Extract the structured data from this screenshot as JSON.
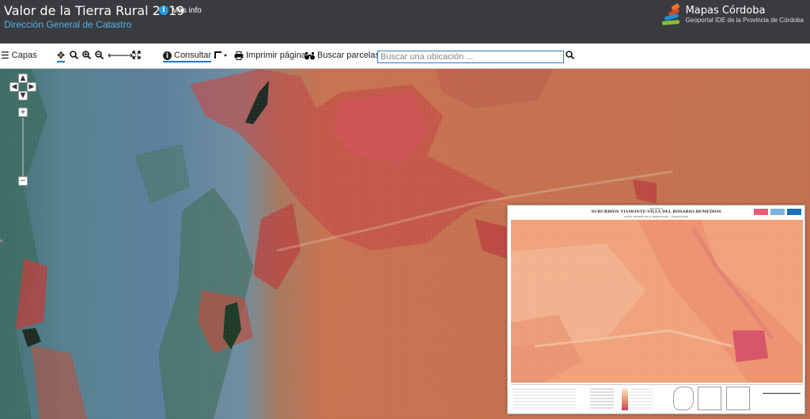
{
  "header": {
    "title": "Valor de la Tierra Rural 2019",
    "subtitle": "Dirección General de Catastro",
    "more_info": "Más info",
    "brand_name": "Mapas Córdoba",
    "brand_tagline": "Geoportal IDE de la Provincia de Córdoba"
  },
  "toolbar": {
    "layers_label": "Capas",
    "consult_label": "Consultar",
    "print_label": "Imprimir página",
    "parcel_label": "Buscar parcelas",
    "search_placeholder": "Buscar una ubicación ..."
  },
  "icons": {
    "menu": "hamburger-icon",
    "pan": "move-arrows-icon",
    "zoom_search": "magnifier-icon",
    "zoom_in": "zoom-in-icon",
    "zoom_out": "zoom-out-icon",
    "back": "arrow-left-icon",
    "forward": "arrow-right-icon",
    "extent": "full-extent-icon",
    "info": "info-icon",
    "measure": "measure-icon",
    "print": "printer-icon",
    "binoculars": "binoculars-icon",
    "search": "search-icon"
  },
  "map": {
    "zoom_in_label": "+",
    "zoom_out_label": "−"
  },
  "inset": {
    "kicker": "PROVINCIA",
    "title": "SUBURBIOS VIAMONTE-VILLA DEL ROSARIO-REMEDIOS",
    "subtitle": "VALOR UNITARIO DE LA TIERRA RURAL - VIGENCIA 2019"
  },
  "colors": {
    "header_bg": "#393b3e",
    "subtitle": "#4fb4e8",
    "accent": "#1f78c8",
    "map_blue": "#5a7f96",
    "map_red": "#c0504a",
    "map_orange": "#c9714f"
  }
}
